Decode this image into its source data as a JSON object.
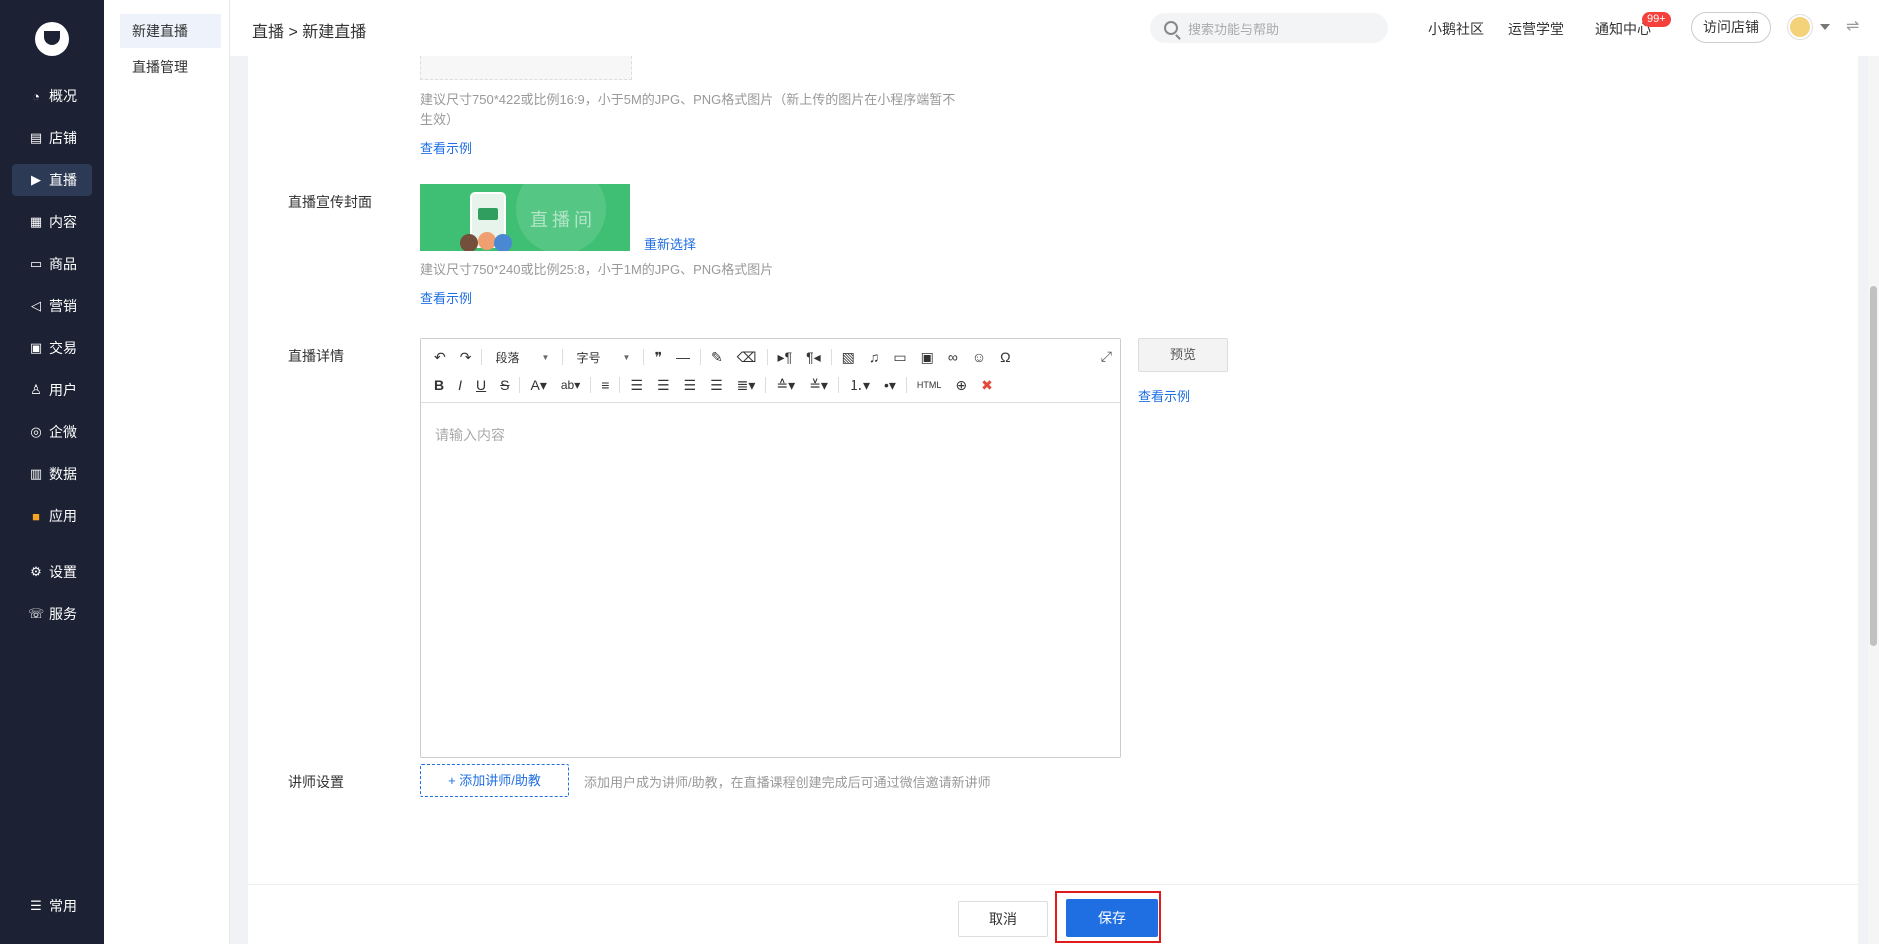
{
  "sidebar": {
    "items": [
      {
        "label": "概况",
        "icon": "◔"
      },
      {
        "label": "店铺",
        "icon": "▤"
      },
      {
        "label": "直播",
        "icon": "▶"
      },
      {
        "label": "内容",
        "icon": "▦"
      },
      {
        "label": "商品",
        "icon": "▭"
      },
      {
        "label": "营销",
        "icon": "◁"
      },
      {
        "label": "交易",
        "icon": "▣"
      },
      {
        "label": "用户",
        "icon": "♙"
      },
      {
        "label": "企微",
        "icon": "◎"
      },
      {
        "label": "数据",
        "icon": "▥"
      },
      {
        "label": "应用",
        "icon": "■"
      }
    ],
    "settings_label": "设置",
    "service_label": "服务",
    "common_label": "常用"
  },
  "submenu": {
    "items": [
      "新建直播",
      "直播管理"
    ]
  },
  "topbar": {
    "breadcrumb": "直播 > 新建直播",
    "search_placeholder": "搜索功能与帮助",
    "links": [
      "小鹅社区",
      "运营学堂",
      "通知中心"
    ],
    "notify_badge": "99+",
    "visit_label": "访问店铺",
    "switch_icon": "⇌"
  },
  "form": {
    "image_hint": "建议尺寸750*422或比例16:9，小于5M的JPG、PNG格式图片（新上传的图片在小程序端暂不",
    "image_hint_2": "生效）",
    "example_link": "查看示例",
    "cover_label": "直播宣传封面",
    "cover_text": "直播间",
    "reselect": "重新选择",
    "cover_hint": "建议尺寸750*240或比例25:8，小于1M的JPG、PNG格式图片",
    "detail_label": "直播详情",
    "editor": {
      "paragraph": "段落",
      "fontsize": "字号",
      "placeholder": "请输入内容",
      "html_label": "HTML"
    },
    "preview_label": "预览",
    "teacher_label": "讲师设置",
    "add_teacher": "+ 添加讲师/助教",
    "teacher_hint": "添加用户成为讲师/助教，在直播课程创建完成后可通过微信邀请新讲师"
  },
  "footer": {
    "cancel": "取消",
    "save": "保存"
  },
  "colors": {
    "sidebar_bg": "#1c2233",
    "accent": "#1f6fe3",
    "highlight": "#e01b1b"
  }
}
